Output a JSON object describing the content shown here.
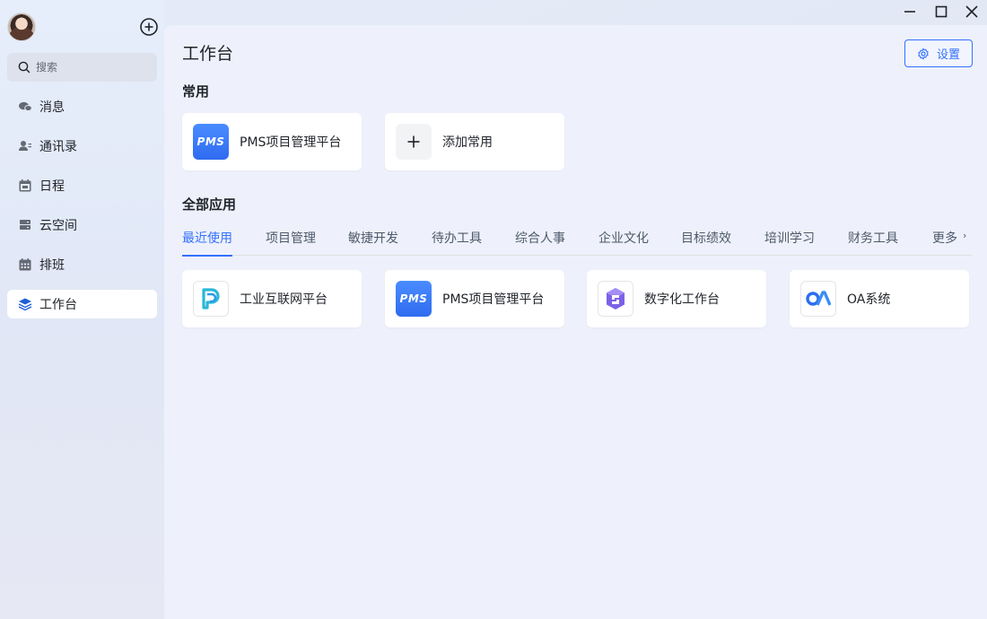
{
  "sidebar": {
    "search_placeholder": "搜索",
    "items": [
      {
        "label": "消息",
        "icon": "chat-icon"
      },
      {
        "label": "通讯录",
        "icon": "contacts-icon"
      },
      {
        "label": "日程",
        "icon": "calendar-icon"
      },
      {
        "label": "云空间",
        "icon": "cloud-space-icon"
      },
      {
        "label": "排班",
        "icon": "schedule-icon"
      },
      {
        "label": "工作台",
        "icon": "workbench-icon",
        "active": true
      }
    ]
  },
  "header": {
    "title": "工作台",
    "settings_label": "设置"
  },
  "common": {
    "title": "常用",
    "items": [
      {
        "label": "PMS项目管理平台",
        "icon_text": "PMS",
        "icon": "pms-icon"
      },
      {
        "label": "添加常用",
        "icon": "plus-icon"
      }
    ]
  },
  "all_apps": {
    "title": "全部应用",
    "tabs": [
      "最近使用",
      "项目管理",
      "敏捷开发",
      "待办工具",
      "综合人事",
      "企业文化",
      "目标绩效",
      "培训学习",
      "财务工具",
      "更多"
    ],
    "active_tab": "最近使用",
    "items": [
      {
        "label": "工业互联网平台",
        "icon": "industrial-internet-icon"
      },
      {
        "label": "PMS项目管理平台",
        "icon_text": "PMS",
        "icon": "pms-icon"
      },
      {
        "label": "数字化工作台",
        "icon": "digital-workbench-icon"
      },
      {
        "label": "OA系统",
        "icon": "oa-icon"
      }
    ]
  },
  "colors": {
    "accent": "#3370ff",
    "sidebar_bg": "#e4ebf8",
    "main_bg": "#eef1fb"
  }
}
